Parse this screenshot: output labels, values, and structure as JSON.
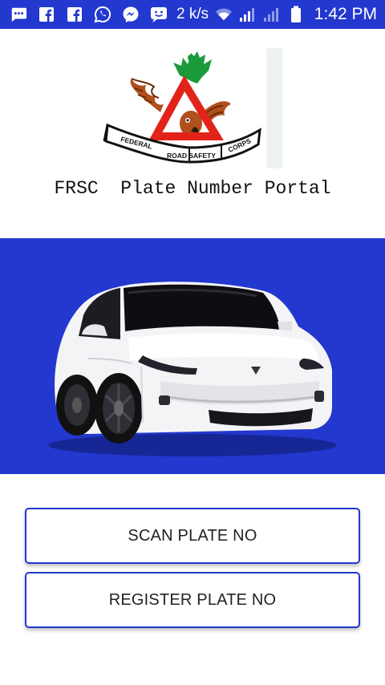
{
  "status_bar": {
    "speed": "2 k/s",
    "time": "1:42 PM",
    "icons": [
      "messages-icon",
      "facebook-icon",
      "facebook-icon",
      "whatsapp-icon",
      "messenger-icon",
      "chat-icon",
      "wifi-icon",
      "signal-icon",
      "signal-icon",
      "battery-icon"
    ]
  },
  "logo": {
    "name": "frsc-logo",
    "banner_text": [
      "FEDERAL",
      "ROAD SAFETY",
      "CORPS"
    ]
  },
  "title": "FRSC  Plate Number Portal",
  "hero": {
    "image": "white-suv-car",
    "background": "#2238cf"
  },
  "buttons": {
    "scan_label": "SCAN PLATE NO",
    "register_label": "REGISTER PLATE NO"
  },
  "colors": {
    "accent": "#2238cf",
    "logo_red": "#e2231a",
    "logo_green": "#1a9a3a",
    "eagle_brown": "#b0501c"
  }
}
